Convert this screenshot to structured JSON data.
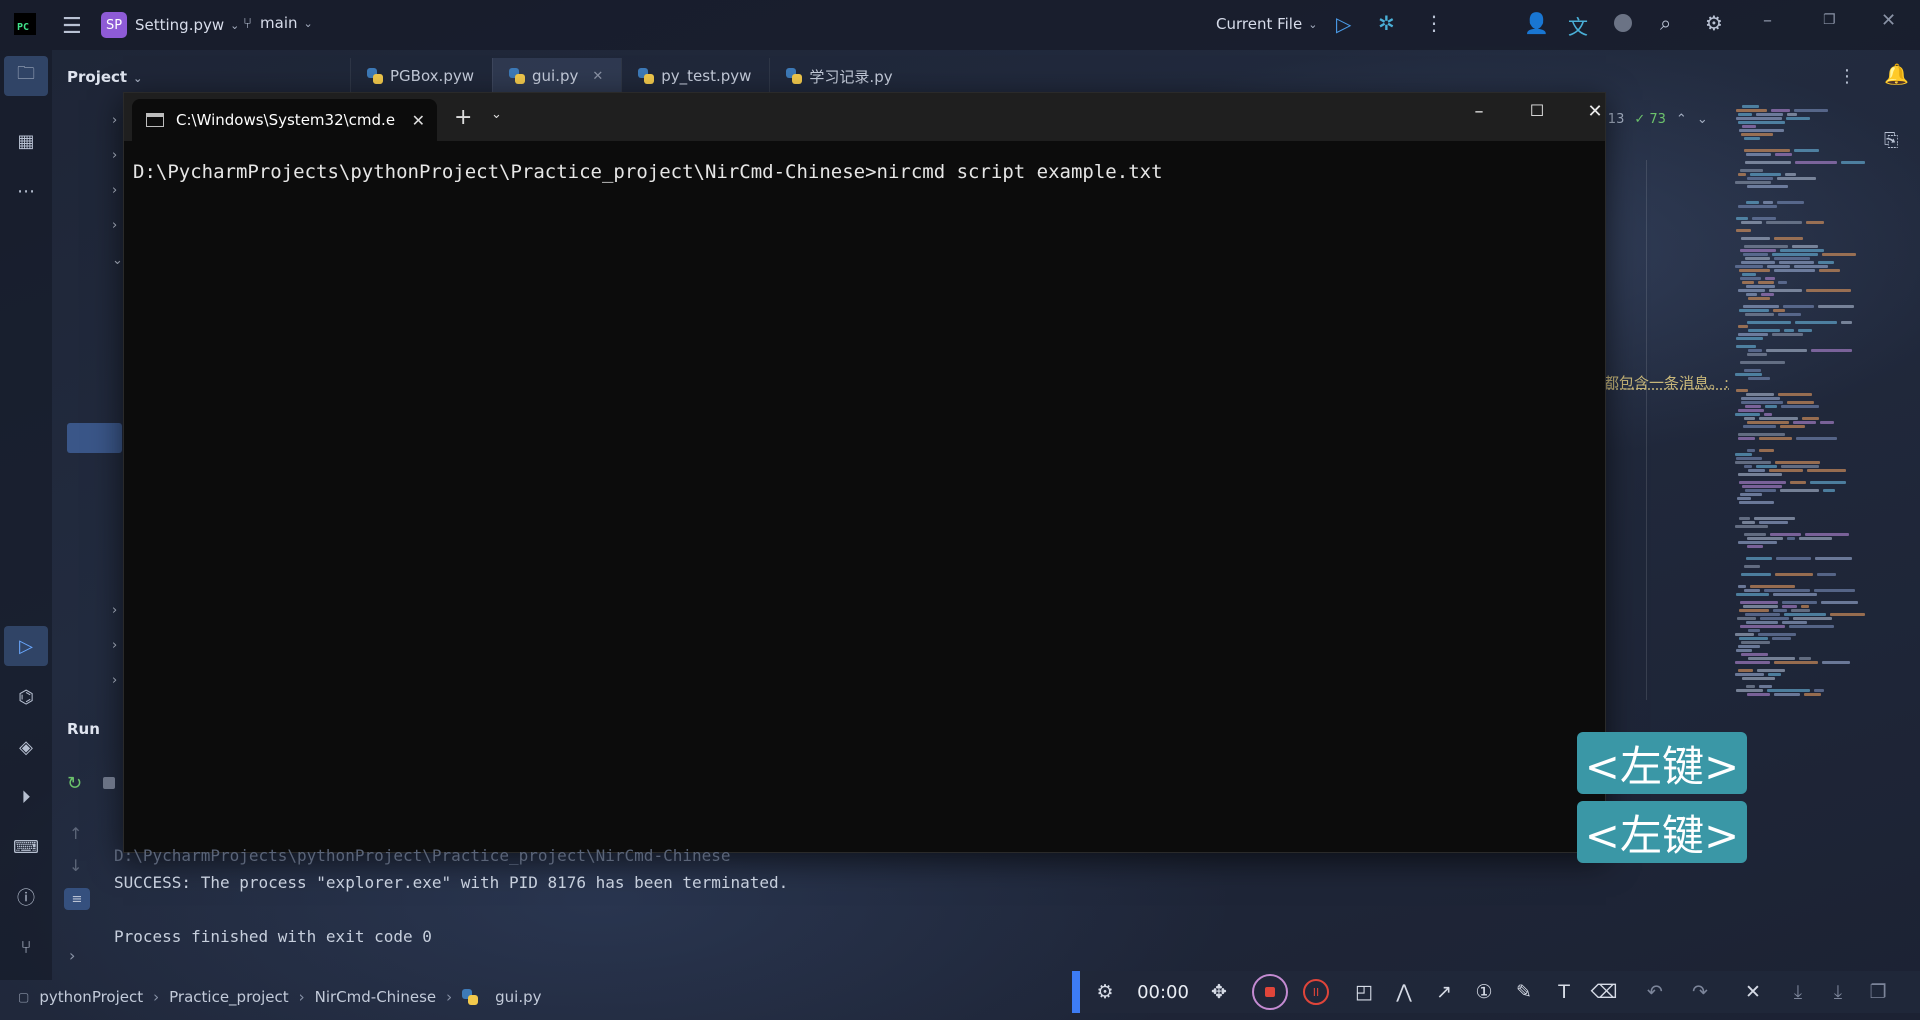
{
  "topbar": {
    "logo_text": "PC",
    "project_badge": "SP",
    "project_file": "Setting.pyw",
    "branch": "main",
    "run_config": "Current File"
  },
  "project_panel": {
    "title": "Project"
  },
  "editor_tabs": [
    {
      "label": "PGBox.pyw"
    },
    {
      "label": "gui.py"
    },
    {
      "label": "py_test.pyw"
    },
    {
      "label": "学习记录.py"
    }
  ],
  "inspections": {
    "warnings": "13",
    "ok": "73"
  },
  "editor_hint": "都包含一条消息。:",
  "cmd": {
    "tab_title": "C:\\Windows\\System32\\cmd.e",
    "prompt_line": "D:\\PycharmProjects\\pythonProject\\Practice_project\\NirCmd-Chinese>nircmd script example.txt"
  },
  "run_panel": {
    "title": "Run",
    "partial_line": "D:\\PycharmProjects\\pythonProject\\Practice_project\\NirCmd-Chinese",
    "success_line": "SUCCESS: The process \"explorer.exe\" with PID 8176 has been terminated.",
    "exit_line": "Process finished with exit code 0"
  },
  "key_overlays": [
    "<左键>",
    "<左键>"
  ],
  "breadcrumb": [
    "pythonProject",
    "Practice_project",
    "NirCmd-Chinese",
    "gui.py"
  ],
  "recorder": {
    "timer": "00:00"
  },
  "colors": {
    "accent": "#3d7cf5",
    "keycap": "#3a97a6",
    "record": "#e0453a"
  }
}
